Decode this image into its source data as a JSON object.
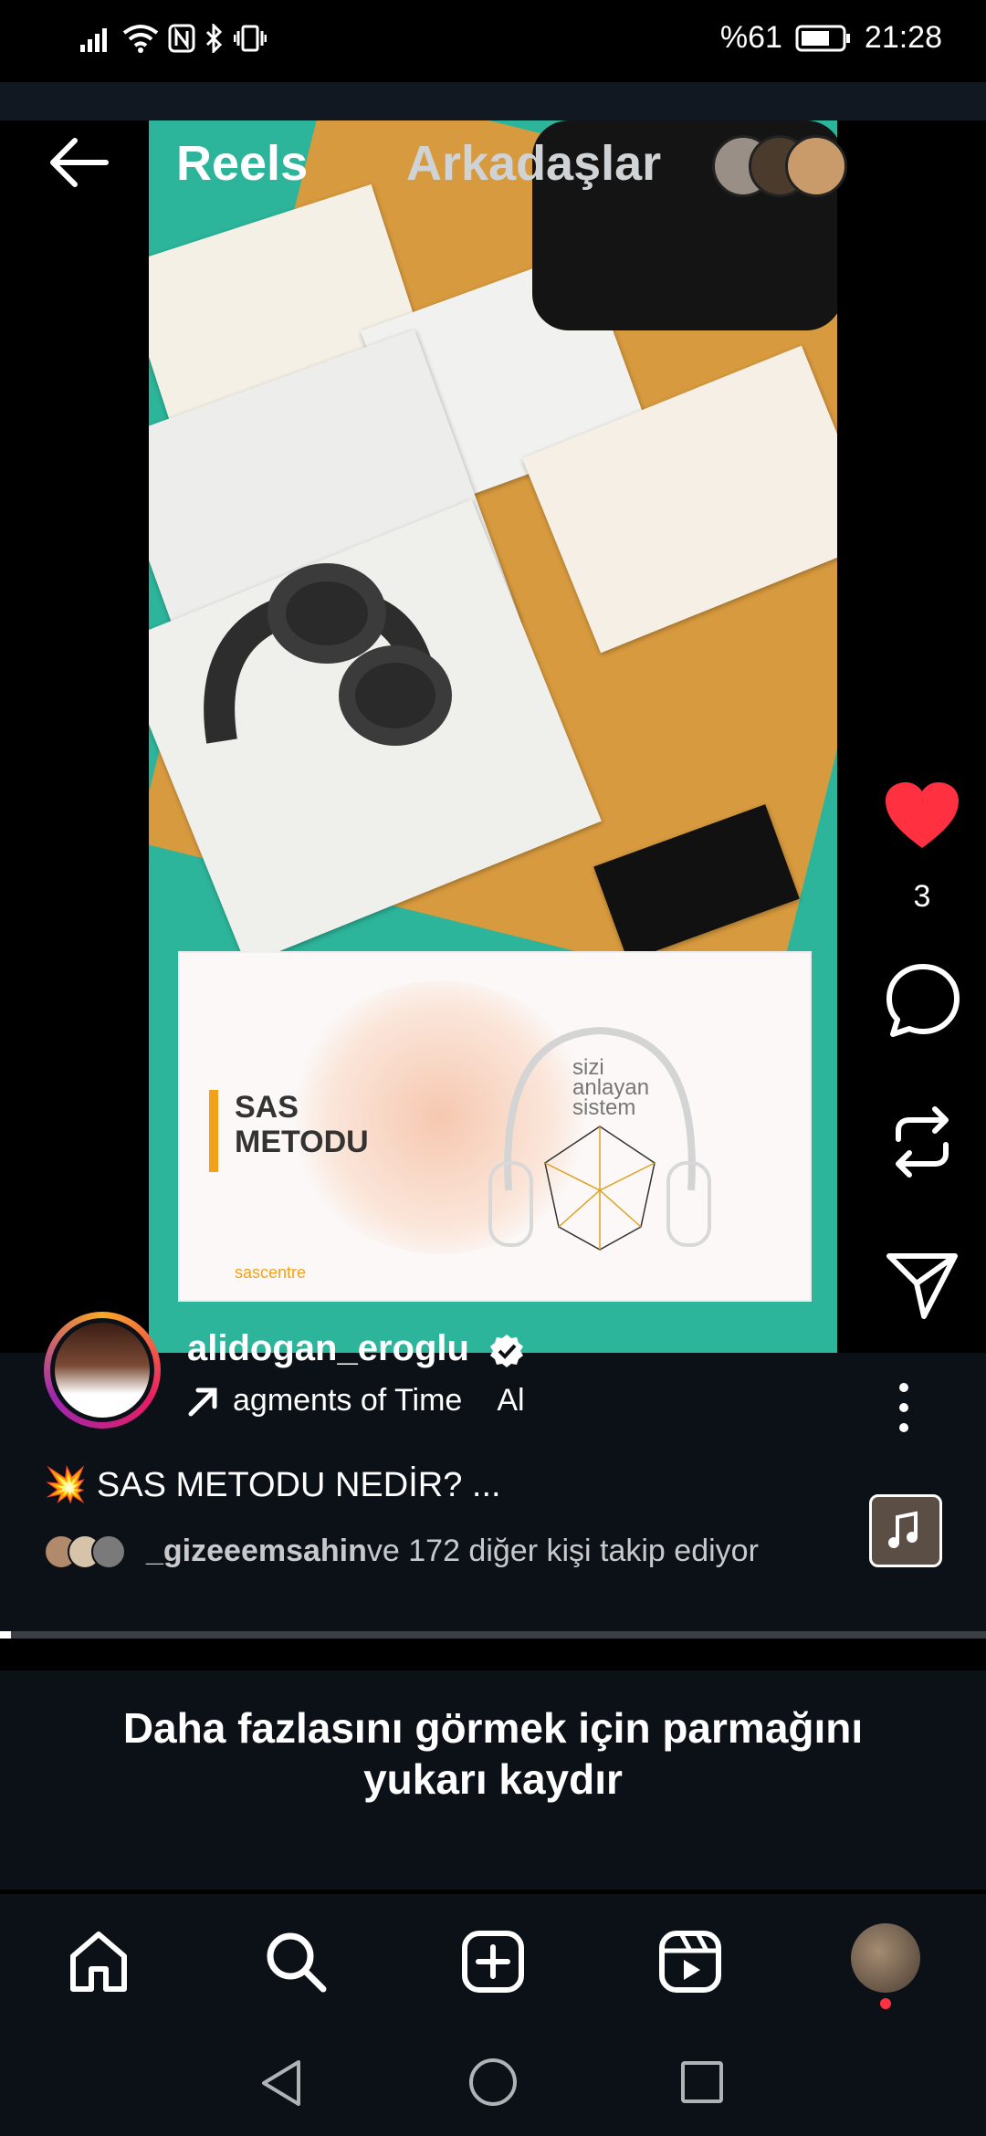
{
  "status_bar": {
    "battery": "%61",
    "time": "21:28"
  },
  "header": {
    "title_reels": "Reels",
    "title_friends": "Arkadaşlar"
  },
  "video": {
    "slide_title_line1": "SAS",
    "slide_title_line2": "METODU",
    "slide_tagline": "sizi\nanlayan\nsistem",
    "slide_logo": "sascentre"
  },
  "actions": {
    "like_count": "3",
    "liked_color": "#ff3040"
  },
  "post": {
    "username": "alidogan_eroglu",
    "music": "agments of Time",
    "music_artist": "Al",
    "caption": "💥 SAS METODU NEDİR? ...",
    "followed_by_user": "_gizeeemsahin",
    "followed_by_rest": " ve 172 diğer kişi takip ediyor"
  },
  "swipe_hint": "Daha fazlasını görmek için parmağını yukarı kaydır",
  "icons": {
    "back": "arrow-left-icon",
    "like": "heart-icon",
    "comment": "comment-icon",
    "repost": "repost-icon",
    "share": "send-icon",
    "more": "more-vertical-icon",
    "home": "home-icon",
    "search": "search-icon",
    "create": "plus-square-icon",
    "reels": "reels-icon",
    "profile": "profile-avatar"
  }
}
